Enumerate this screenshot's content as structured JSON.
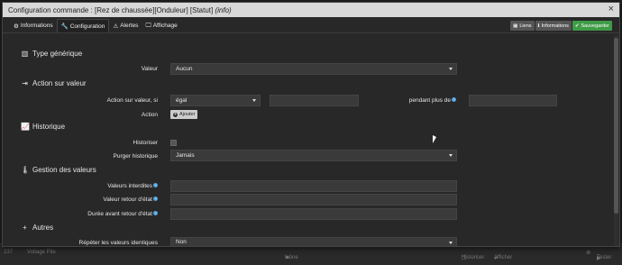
{
  "modal": {
    "title": "Configuration commande : [Rez de chaussée][Onduleur] [Statut]",
    "title_info": "(info)",
    "close": "×"
  },
  "tabs": [
    {
      "label": "Informations",
      "icon": "⚙"
    },
    {
      "label": "Configuration",
      "icon": "🔧"
    },
    {
      "label": "Alertes",
      "icon": "⚠"
    },
    {
      "label": "Affichage",
      "icon": "🖵"
    }
  ],
  "actions": {
    "links": "Liens",
    "informations": "Informations",
    "save": "Sauvegarder"
  },
  "sections": {
    "type": "Type générique",
    "action": "Action sur valeur",
    "history": "Historique",
    "values": "Gestion des valeurs",
    "others": "Autres"
  },
  "fields": {
    "valeur_label": "Valeur",
    "valeur_value": "Aucun",
    "action_label": "Action sur valeur, si",
    "action_op": "égal",
    "action_value": "",
    "pendant_label": "pendant plus de",
    "pendant_value": "",
    "action2_label": "Action",
    "add_button": "Ajouter",
    "historiser_label": "Historiser",
    "purger_label": "Purger historique",
    "purger_value": "Jamais",
    "interdites_label": "Valeurs interdites",
    "interdites_value": "",
    "retour_label": "Valeur retour d'état",
    "retour_value": "",
    "duree_label": "Durée avant retour d'état",
    "duree_value": "",
    "repeter_label": "Répéter les valeurs identiques",
    "repeter_value": "Non"
  },
  "background": {
    "id": "237",
    "name": "Voltage Pile",
    "icon_label": "Icône",
    "historiser": "Historiser",
    "afficher": "Afficher",
    "tester": "Tester"
  }
}
